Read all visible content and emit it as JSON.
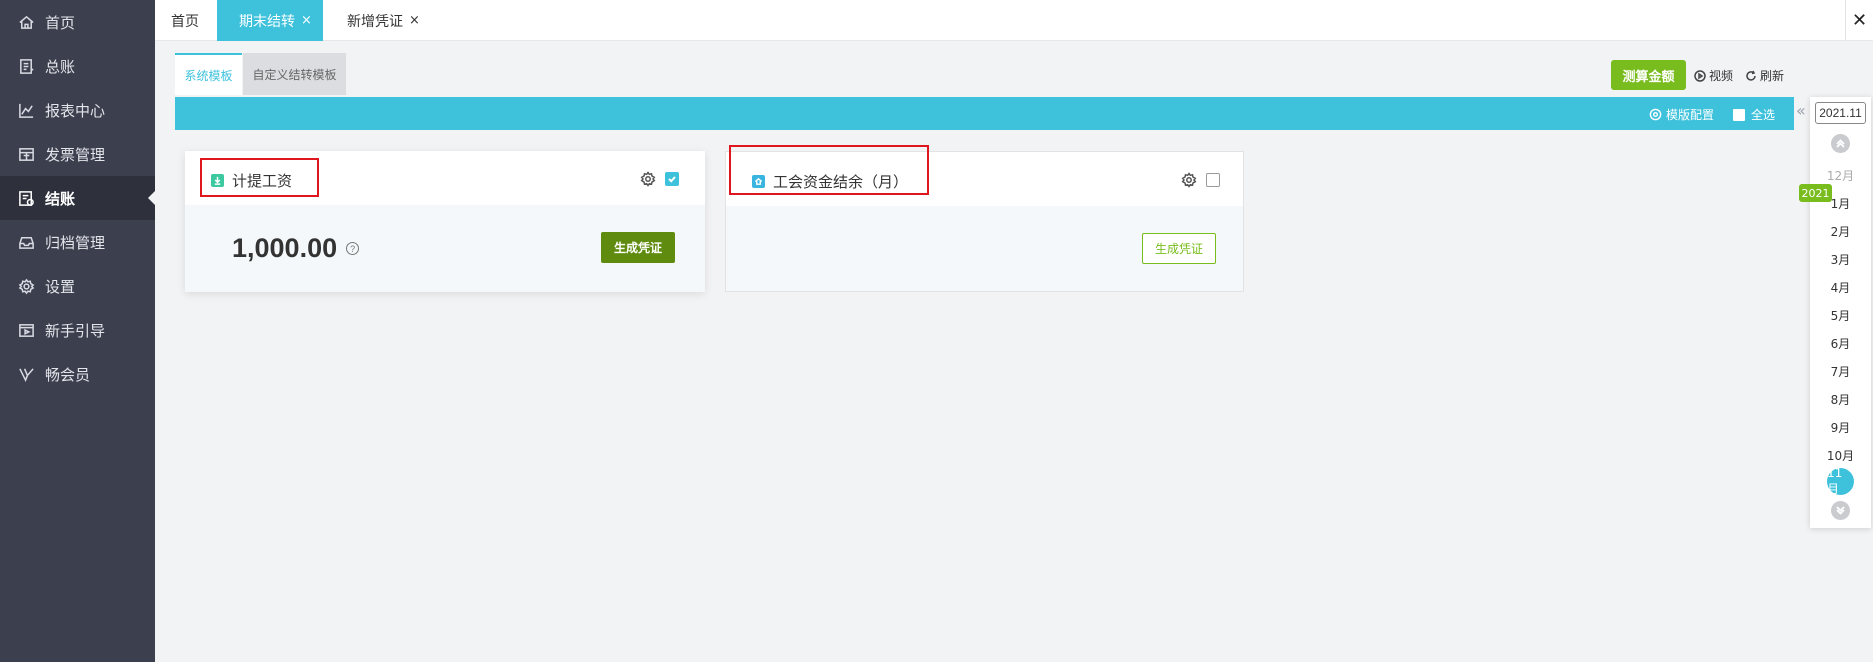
{
  "sidebar": {
    "items": [
      {
        "label": "首页",
        "icon": "home-icon"
      },
      {
        "label": "总账",
        "icon": "ledger-icon"
      },
      {
        "label": "报表中心",
        "icon": "chart-icon"
      },
      {
        "label": "发票管理",
        "icon": "invoice-icon"
      },
      {
        "label": "结账",
        "icon": "checkout-icon",
        "active": true
      },
      {
        "label": "归档管理",
        "icon": "archive-icon"
      },
      {
        "label": "设置",
        "icon": "gear-icon"
      },
      {
        "label": "新手引导",
        "icon": "play-icon"
      },
      {
        "label": "畅会员",
        "icon": "vip-icon"
      }
    ]
  },
  "tabs": {
    "home": "首页",
    "period_close": "期末结转",
    "new_voucher": "新增凭证",
    "close_symbol": "×",
    "close_all": "✕"
  },
  "subtabs": {
    "system": "系统模板",
    "custom": "自定义结转模板"
  },
  "toolbar": {
    "calc_amount": "测算金额",
    "video": "视频",
    "refresh": "刷新",
    "template_config": "模版配置",
    "select_all": "全选",
    "collapse": "«"
  },
  "cards": [
    {
      "title": "计提工资",
      "amount": "1,000.00",
      "help": "?",
      "checked": true,
      "button": "生成凭证"
    },
    {
      "title": "工会资金结余（月）",
      "checked": false,
      "button": "生成凭证"
    }
  ],
  "period": {
    "input_value": "2021.11",
    "year_badge": "2021",
    "months": [
      "12月",
      "1月",
      "2月",
      "3月",
      "4月",
      "5月",
      "6月",
      "7月",
      "8月",
      "9月",
      "10月"
    ],
    "active_month": "11月"
  },
  "colors": {
    "accent_teal": "#3ec2dc",
    "accent_green": "#78bc1d",
    "dark_green": "#5f8c0f",
    "sidebar_bg": "#3c3f4e",
    "highlight_red": "#e0161f"
  }
}
